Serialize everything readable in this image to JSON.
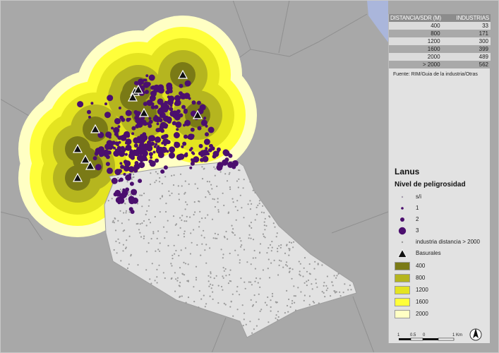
{
  "table": {
    "headers": [
      "DISTANCIA/SDR (M)",
      "INDUSTRIAS"
    ],
    "rows": [
      {
        "distance": "400",
        "count": "33"
      },
      {
        "distance": "800",
        "count": "171"
      },
      {
        "distance": "1200",
        "count": "300"
      },
      {
        "distance": "1600",
        "count": "399"
      },
      {
        "distance": "2000",
        "count": "489"
      },
      {
        "distance": "> 2000",
        "count": "562"
      }
    ]
  },
  "source": "Fuente: RIM/Guia de la industria/Otras",
  "legend": {
    "title": "Lanus",
    "subtitle": "Nivel de peligrosidad",
    "danger_levels": [
      {
        "label": "s/i",
        "color": "#a39aaa"
      },
      {
        "label": "1",
        "color": "#4b0f6e"
      },
      {
        "label": "2",
        "color": "#4b0f6e"
      },
      {
        "label": "3",
        "color": "#4b0f6e"
      }
    ],
    "far_industry": {
      "label": "industria distancia > 2000",
      "color": "#9a9a9a"
    },
    "dumps": {
      "label": "Basurales",
      "icon": "triangle-icon"
    },
    "buffers": [
      {
        "label": "400",
        "color": "#7a7a16"
      },
      {
        "label": "800",
        "color": "#b5b51f"
      },
      {
        "label": "1200",
        "color": "#e4e420"
      },
      {
        "label": "1600",
        "color": "#ffff3a"
      },
      {
        "label": "2000",
        "color": "#ffffc4"
      }
    ]
  },
  "scale": {
    "labels": [
      "1",
      "0.5",
      "0",
      "1 Km"
    ]
  },
  "colors": {
    "background": "#a8a8a8",
    "district": "#e2e2e2",
    "water": "#aab6db",
    "industry": "#4b0f6e"
  }
}
